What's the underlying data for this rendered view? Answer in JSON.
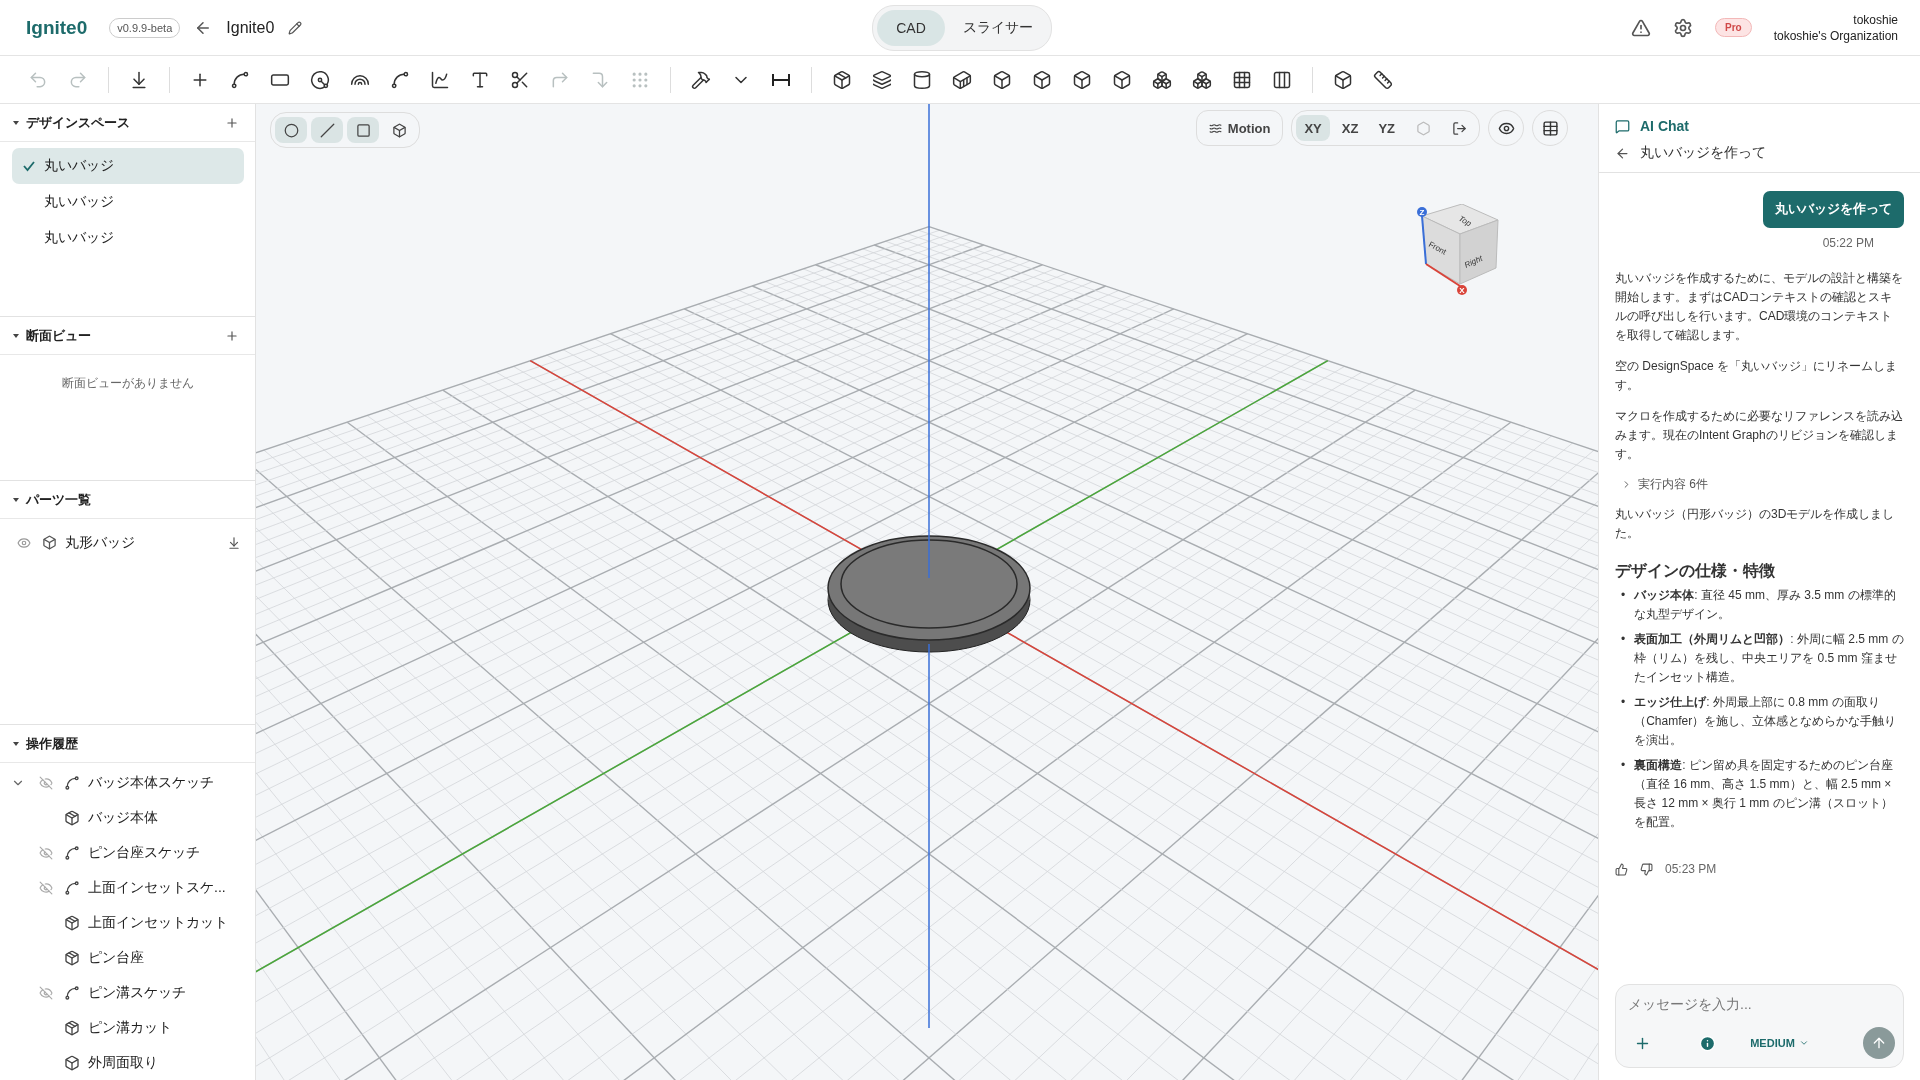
{
  "app": {
    "logo": "Ignite0",
    "version": "v0.9.9-beta",
    "project_title": "Ignite0"
  },
  "mode_tabs": [
    {
      "label": "CAD",
      "selected": true
    },
    {
      "label": "スライサー",
      "selected": false
    }
  ],
  "user": {
    "plan": "Pro",
    "name": "tokoshie",
    "organization": "tokoshie's Organization"
  },
  "toolbar": {
    "undo": {
      "disabled": true
    },
    "redo": {
      "disabled": true
    }
  },
  "sidebar": {
    "design_spaces": {
      "title": "デザインスペース",
      "items": [
        {
          "label": "丸いバッジ",
          "selected": true
        },
        {
          "label": "丸いバッジ",
          "selected": false
        },
        {
          "label": "丸いバッジ",
          "selected": false
        }
      ]
    },
    "section_views": {
      "title": "断面ビュー",
      "empty": "断面ビューがありません"
    },
    "parts": {
      "title": "パーツ一覧",
      "items": [
        {
          "label": "丸形バッジ"
        }
      ]
    },
    "history": {
      "title": "操作履歴",
      "items": [
        {
          "label": "バッジ本体スケッチ",
          "kind": "sketch",
          "expanded": true
        },
        {
          "label": "バッジ本体",
          "kind": "extrude"
        },
        {
          "label": "ピン台座スケッチ",
          "kind": "sketch"
        },
        {
          "label": "上面インセットスケ...",
          "kind": "sketch"
        },
        {
          "label": "上面インセットカット",
          "kind": "extrude"
        },
        {
          "label": "ピン台座",
          "kind": "extrude"
        },
        {
          "label": "ピン溝スケッチ",
          "kind": "sketch"
        },
        {
          "label": "ピン溝カット",
          "kind": "extrude"
        },
        {
          "label": "外周面取り",
          "kind": "chamfer"
        }
      ]
    }
  },
  "viewport": {
    "select_modes": [
      {
        "kind": "vertex",
        "selected": true
      },
      {
        "kind": "edge",
        "selected": true
      },
      {
        "kind": "face",
        "selected": true
      },
      {
        "kind": "body",
        "selected": false
      }
    ],
    "motion": "Motion",
    "planes": [
      {
        "label": "XY",
        "selected": true
      },
      {
        "label": "XZ",
        "selected": false
      },
      {
        "label": "YZ",
        "selected": false
      }
    ],
    "view_cube": {
      "top": "Top",
      "front": "Front",
      "right": "Right",
      "z": "Z",
      "x": "X"
    }
  },
  "chat": {
    "title": "AI Chat",
    "thread_title": "丸いバッジを作って",
    "user_message": {
      "text": "丸いバッジを作って",
      "time": "05:22 PM"
    },
    "reply": {
      "blocks": [
        {
          "kind": "paragraph",
          "text": "丸いバッジを作成するために、モデルの設計と構築を開始します。まずはCADコンテキストの確認とスキルの呼び出しを行います。CAD環境のコンテキストを取得して確認します。"
        },
        {
          "kind": "paragraph",
          "text": "空の DesignSpace を「丸いバッジ」にリネームします。"
        },
        {
          "kind": "paragraph",
          "text": "マクロを作成するために必要なリファレンスを読み込みます。現在のIntent Graphのリビジョンを確認します。"
        },
        {
          "kind": "steps",
          "text": "実行内容 6件",
          "expanded": false
        },
        {
          "kind": "paragraph",
          "text": "丸いバッジ（円形バッジ）の3Dモデルを作成しました。"
        },
        {
          "kind": "heading",
          "text": "デザインの仕様・特徴"
        },
        {
          "kind": "list",
          "marker": "•",
          "items": [
            "**バッジ本体**: 直径 45 mm、厚み 3.5 mm の標準的な丸型デザイン。",
            "**表面加工（外周リムと凹部）**: 外周に幅 2.5 mm の枠（リム）を残し、中央エリアを 0.5 mm 窪ませたインセット構造。",
            "**エッジ仕上げ**: 外周最上部に 0.8 mm の面取り（Chamfer）を施し、立体感となめらかな手触りを演出。",
            "**裏面構造**: ピン留め具を固定するためのピン台座（直径 16 mm、高さ 1.5 mm）と、幅 2.5 mm × 長さ 12 mm × 奥行 1 mm のピン溝（スロット）を配置。"
          ]
        }
      ],
      "time": "05:23 PM"
    },
    "input": {
      "placeholder": "メッセージを入力...",
      "effort": "MEDIUM"
    }
  }
}
